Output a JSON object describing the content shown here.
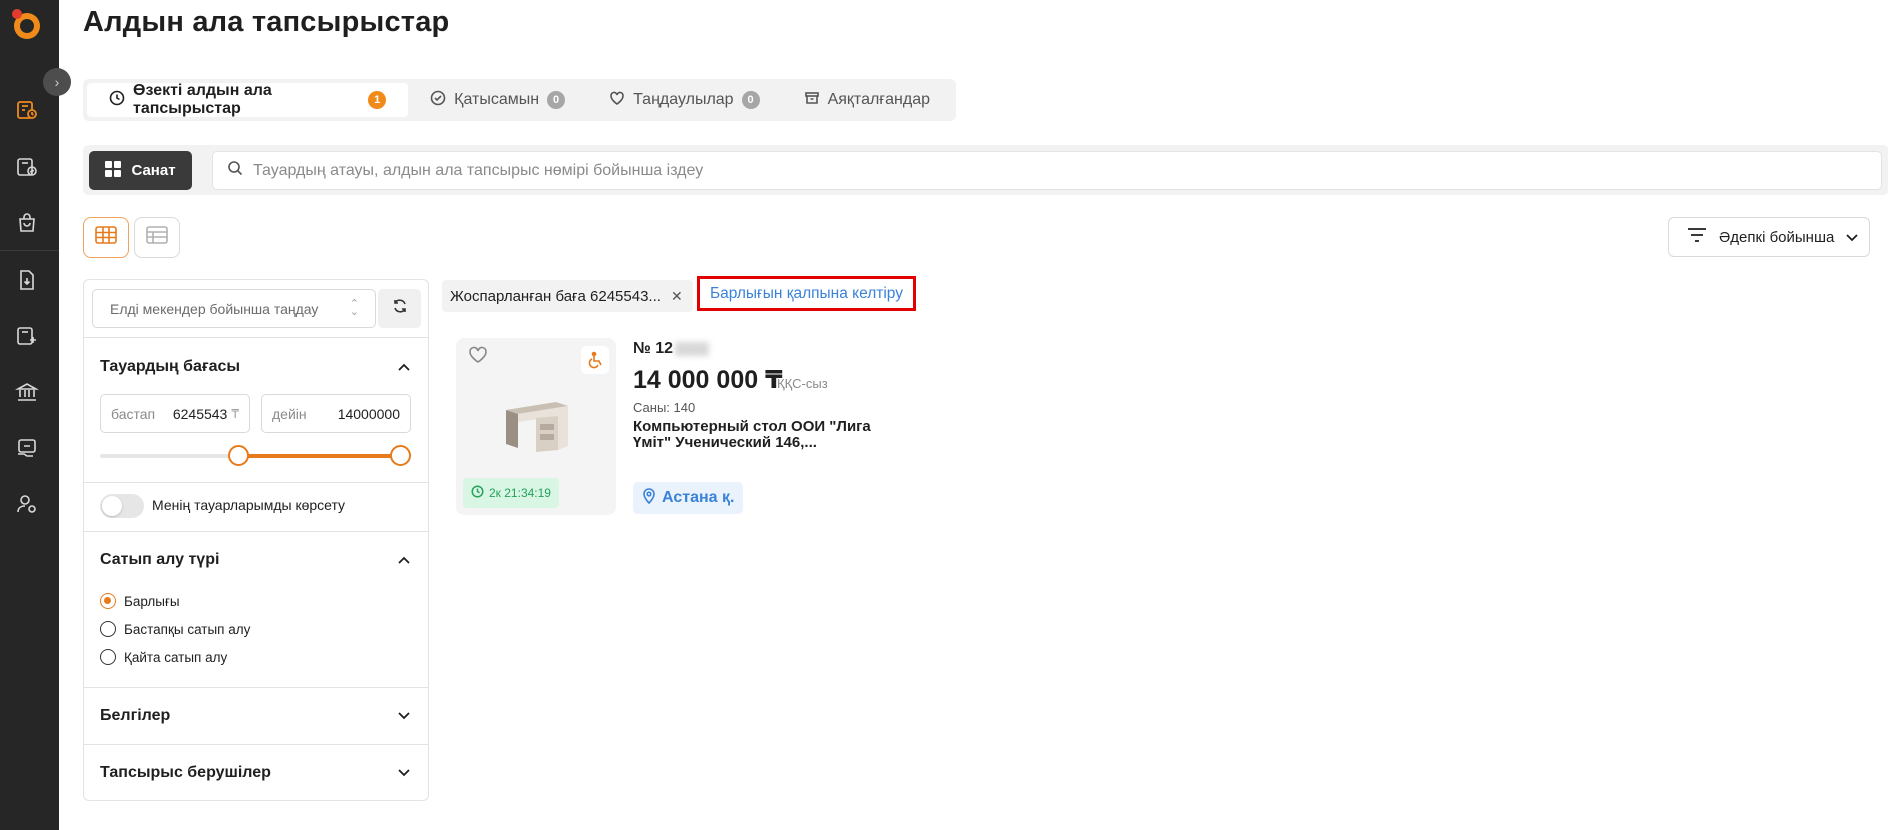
{
  "page": {
    "title": "Алдын ала тапсырыстар"
  },
  "tabs": [
    {
      "label": "Өзекті алдын ала тапсырыстар",
      "count": "1",
      "icon": "clock-icon",
      "active": true
    },
    {
      "label": "Қатысамын",
      "count": "0",
      "icon": "check-circle-icon",
      "active": false
    },
    {
      "label": "Таңдаулылар",
      "count": "0",
      "icon": "heart-icon",
      "active": false
    },
    {
      "label": "Аяқталғандар",
      "icon": "archive-icon",
      "active": false
    }
  ],
  "search": {
    "category_label": "Санат",
    "placeholder": "Тауардың атауы, алдын ала тапсырыс нөмірі бойынша іздеу"
  },
  "sort": {
    "label": "Әдепкі бойынша"
  },
  "filters": {
    "locality_placeholder": "Елді мекендер бойынша таңдау",
    "price_heading": "Тауардың бағасы",
    "price_from_label": "бастап",
    "price_from_value": "6245543",
    "price_to_label": "дейін",
    "price_to_value": "14000000",
    "currency": "₸",
    "my_products_label": "Менің тауарларымды көрсету",
    "purchase_type_heading": "Сатып алу түрі",
    "purchase_types": [
      {
        "label": "Барлығы",
        "checked": true
      },
      {
        "label": "Бастапқы сатып алу",
        "checked": false
      },
      {
        "label": "Қайта сатып алу",
        "checked": false
      }
    ],
    "tags_heading": "Белгілер",
    "customers_heading": "Тапсырыс берушілер"
  },
  "active_filters": {
    "chip_label": "Жоспарланған баға 6245543...",
    "reset_label": "Барлығын қалпына келтіру"
  },
  "card": {
    "number_prefix": "№ 12",
    "price": "14 000 000 ₸",
    "vat": "ҚҚС-сыз",
    "qty": "Саны: 140",
    "title": "Компьютерный стол ООИ \"Лига Үміт\" Ученический 146,...",
    "timer": "2к 21:34:19",
    "city": "Астана қ."
  },
  "colors": {
    "accent": "#e77a1b",
    "link": "#3b82d9",
    "sidebar": "#262626",
    "timer_bg": "#d9f5e4"
  }
}
